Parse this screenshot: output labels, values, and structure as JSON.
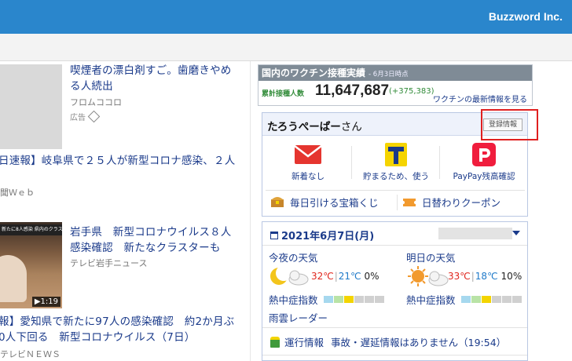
{
  "header": {
    "brand": "Buzzword Inc."
  },
  "news": [
    {
      "headline_l1": "喫煙者の漂白剤すご。歯磨きやめ",
      "headline_l2": "る人続出",
      "source": "フロムココロ",
      "ad": "広告"
    },
    {
      "headline_l1": "日速報】岐阜県で２５人が新型コロナ感染、２人",
      "source": "聞Ｗｅｂ"
    },
    {
      "headline_l1": "岩手県　新型コロナウイルス８人",
      "headline_l2": "感染確認　新たなクラスターも",
      "source": "テレビ岩手ニュース",
      "video_banner": "新たに8人感染 県内のクラス",
      "video_duration": "▶1:19"
    },
    {
      "headline_l1": "報】愛知県で新たに97人の感染確認　約2か月ぶ",
      "headline_l2": "0人下回る　新型コロナウイルス（7日）",
      "source": "テレビＮＥＷＳ"
    }
  ],
  "vaccine": {
    "title": "国内のワクチン接種実績",
    "date": "- 6月3日時点",
    "label": "累計接種人数",
    "total": "11,647,687",
    "delta": "(+375,383)",
    "link": "ワクチンの最新情報を見る"
  },
  "user": {
    "name": "たろうぺーぱー",
    "suffix": "さん",
    "register_label": "登録情報",
    "services": [
      {
        "label": "新着なし",
        "icon": "mail-icon"
      },
      {
        "label": "貯まる、使う",
        "label_prefix": "貯",
        "full": "貯まるため、使う"
      },
      {
        "label": "PayPay残高確認",
        "icon": "paypay-icon"
      }
    ],
    "promo_lottery": "毎日引ける宝箱くじ",
    "promo_coupon": "日替わりクーポン"
  },
  "weather": {
    "date": "2021年6月7日(月)",
    "tonight_label": "今夜の天気",
    "tomorrow_label": "明日の天気",
    "tonight_hi": "32℃",
    "tonight_lo": "21℃",
    "tonight_rain": "0%",
    "tomorrow_hi": "33℃",
    "tomorrow_lo": "18℃",
    "tomorrow_rain": "10%",
    "heat_label": "熱中症指数",
    "radar_label": "雨雲レーダー",
    "train_label": "運行情報",
    "train_status": "事故・遅延情報はありません（19:54）",
    "heat_colors": [
      "#a6d8ee",
      "#b9e3a6",
      "#f3d400",
      "#d0d0d0",
      "#d0d0d0",
      "#d0d0d0"
    ]
  }
}
